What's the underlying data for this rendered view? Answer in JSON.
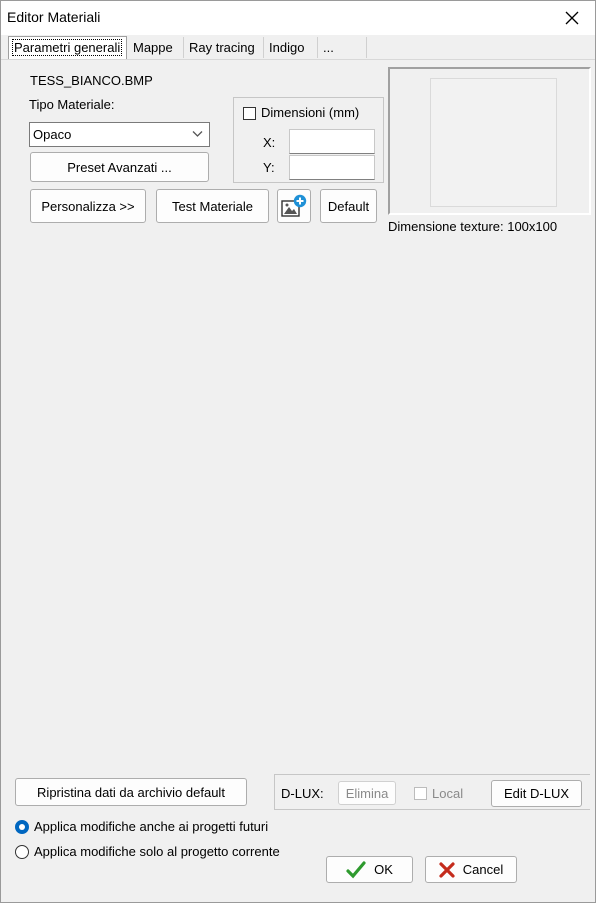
{
  "window": {
    "title": "Editor Materiali"
  },
  "tabs": [
    {
      "label": "Parametri generali"
    },
    {
      "label": "Mappe"
    },
    {
      "label": "Ray tracing"
    },
    {
      "label": "Indigo"
    },
    {
      "label": "..."
    }
  ],
  "texture": {
    "filename": "TESS_BIANCO.BMP"
  },
  "material": {
    "type_label": "Tipo Materiale:",
    "type_value": "Opaco",
    "preset_button": "Preset Avanzati ..."
  },
  "dimensions": {
    "checkbox_label": "Dimensioni (mm)",
    "x_label": "X:",
    "y_label": "Y:",
    "x_value": "",
    "y_value": ""
  },
  "actions": {
    "customize": "Personalizza >>",
    "test": "Test Materiale",
    "default": "Default"
  },
  "preview": {
    "caption": "Dimensione texture:  100x100"
  },
  "archive": {
    "restore_button": "Ripristina dati da archivio default"
  },
  "dlux": {
    "label": "D-LUX:",
    "delete_button": "Elimina",
    "local_label": "Local",
    "edit_button": "Edit D-LUX"
  },
  "apply": {
    "option_future": "Applica modifiche anche ai progetti futuri",
    "option_current": "Applica modifiche solo al progetto corrente",
    "selected": "future"
  },
  "footer": {
    "ok": "OK",
    "cancel": "Cancel"
  },
  "colors": {
    "ok_check": "#2e9a2e",
    "cancel_x": "#c42b1c",
    "radio_accent": "#0067c0",
    "image_badge": "#1e90d6"
  }
}
